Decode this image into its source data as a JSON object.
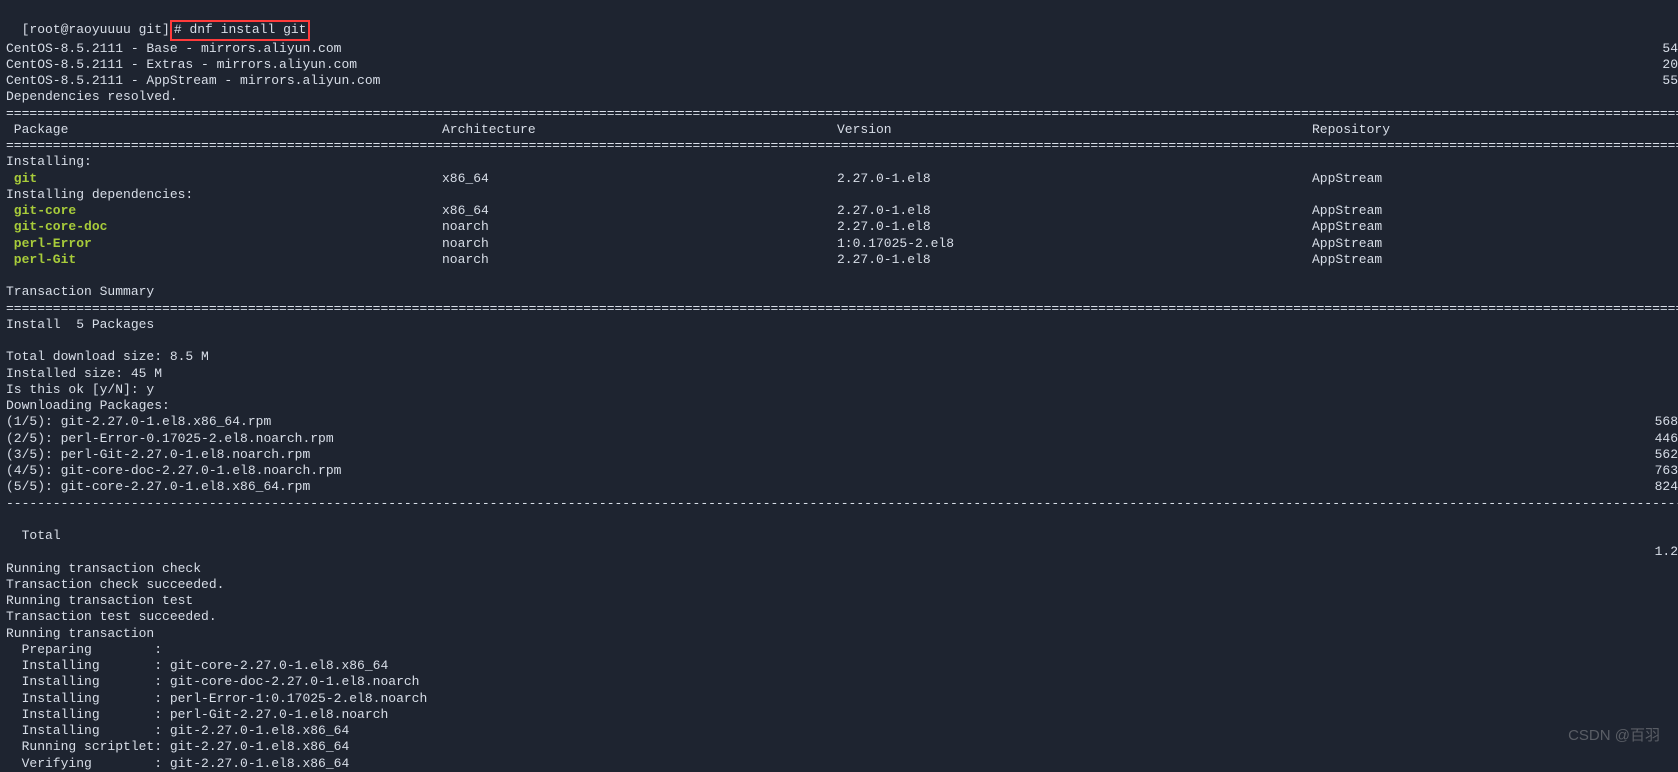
{
  "prompt": {
    "userhost": "[root@raoyuuuu git]",
    "hash": "# ",
    "command": "dnf install git"
  },
  "repos": [
    {
      "text": "CentOS-8.5.2111 - Base - mirrors.aliyun.com",
      "num": "54"
    },
    {
      "text": "CentOS-8.5.2111 - Extras - mirrors.aliyun.com",
      "num": "20"
    },
    {
      "text": "CentOS-8.5.2111 - AppStream - mirrors.aliyun.com",
      "num": "55"
    }
  ],
  "deps_resolved": "Dependencies resolved.",
  "rule_eq": "============================================================================================================================================================================================================================================================",
  "rule_dash": "------------------------------------------------------------------------------------------------------------------------------------------------------------------------------------------------------------------------------------------------------------",
  "headers": {
    "pkg": " Package",
    "arch": "Architecture",
    "ver": "Version",
    "repo": "Repository"
  },
  "installing_label": "Installing:",
  "installing_deps_label": "Installing dependencies:",
  "packages_main": [
    {
      "name": " git",
      "arch": "x86_64",
      "ver": "2.27.0-1.el8",
      "repo": "AppStream"
    }
  ],
  "packages_deps": [
    {
      "name": " git-core",
      "arch": "x86_64",
      "ver": "2.27.0-1.el8",
      "repo": "AppStream"
    },
    {
      "name": " git-core-doc",
      "arch": "noarch",
      "ver": "2.27.0-1.el8",
      "repo": "AppStream"
    },
    {
      "name": " perl-Error",
      "arch": "noarch",
      "ver": "1:0.17025-2.el8",
      "repo": "AppStream"
    },
    {
      "name": " perl-Git",
      "arch": "noarch",
      "ver": "2.27.0-1.el8",
      "repo": "AppStream"
    }
  ],
  "tx_summary": "Transaction Summary",
  "install_count": "Install  5 Packages",
  "size_lines": [
    "Total download size: 8.5 M",
    "Installed size: 45 M"
  ],
  "confirm": "Is this ok [y/N]: y",
  "downloading_label": "Downloading Packages:",
  "downloads": [
    {
      "text": "(1/5): git-2.27.0-1.el8.x86_64.rpm",
      "num": "568"
    },
    {
      "text": "(2/5): perl-Error-0.17025-2.el8.noarch.rpm",
      "num": "446"
    },
    {
      "text": "(3/5): perl-Git-2.27.0-1.el8.noarch.rpm",
      "num": "562"
    },
    {
      "text": "(4/5): git-core-doc-2.27.0-1.el8.noarch.rpm",
      "num": "763"
    },
    {
      "text": "(5/5): git-core-2.27.0-1.el8.x86_64.rpm",
      "num": "824"
    }
  ],
  "total_line": {
    "text": "Total",
    "num": "1.2"
  },
  "tx_lines": [
    "Running transaction check",
    "Transaction check succeeded.",
    "Running transaction test",
    "Transaction test succeeded.",
    "Running transaction"
  ],
  "steps": [
    "  Preparing        :",
    "  Installing       : git-core-2.27.0-1.el8.x86_64",
    "  Installing       : git-core-doc-2.27.0-1.el8.noarch",
    "  Installing       : perl-Error-1:0.17025-2.el8.noarch",
    "  Installing       : perl-Git-2.27.0-1.el8.noarch",
    "  Installing       : git-2.27.0-1.el8.x86_64",
    "  Running scriptlet: git-2.27.0-1.el8.x86_64",
    "  Verifying        : git-2.27.0-1.el8.x86_64"
  ],
  "watermark": "CSDN @百羽"
}
